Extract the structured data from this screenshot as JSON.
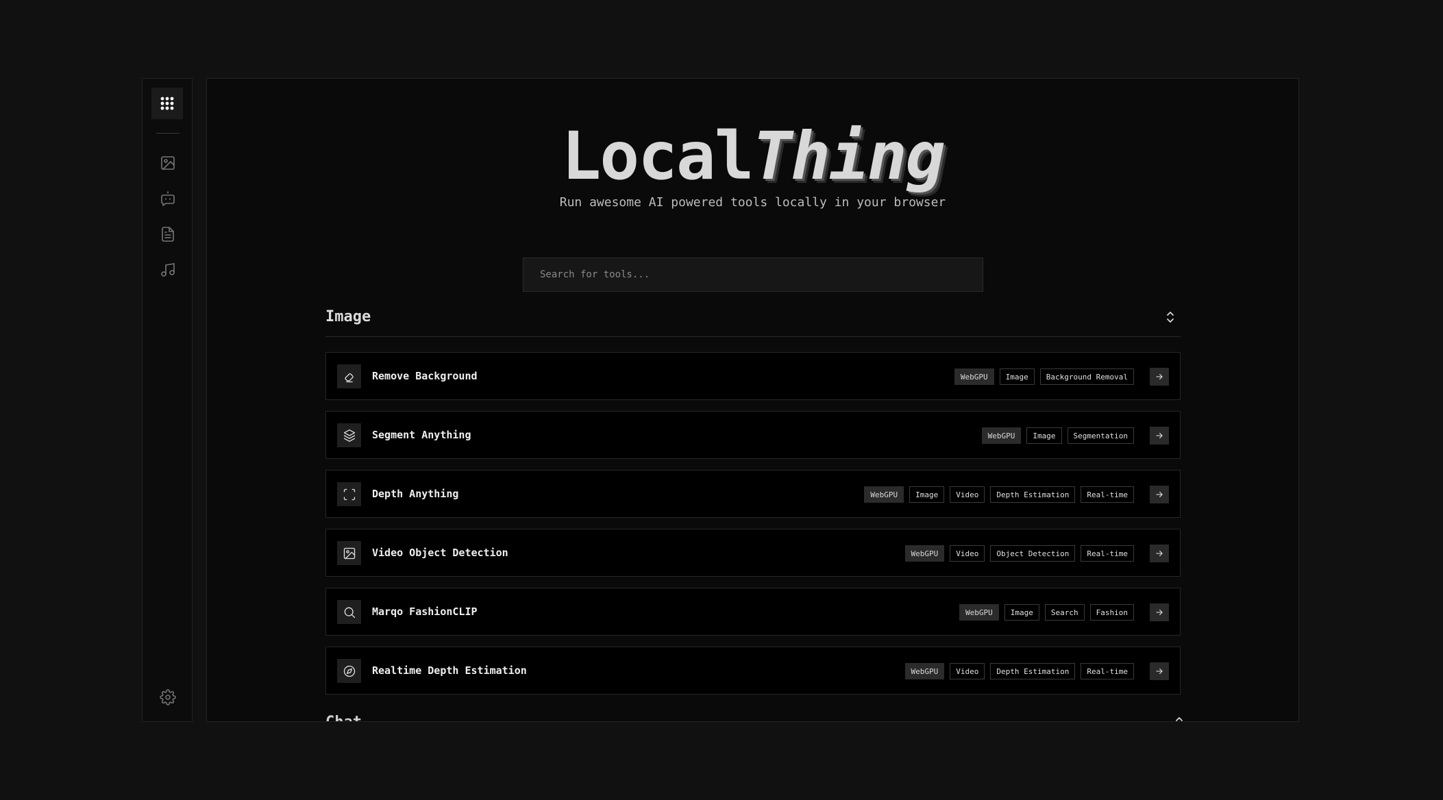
{
  "sidebar": {
    "logo_icon": "grid-dots-icon",
    "items": [
      {
        "name": "image",
        "icon": "image-icon"
      },
      {
        "name": "chat",
        "icon": "chat-bot-icon"
      },
      {
        "name": "document",
        "icon": "document-icon"
      },
      {
        "name": "audio",
        "icon": "music-note-icon"
      }
    ],
    "settings_icon": "gear-icon"
  },
  "hero": {
    "title_plain": "Local",
    "title_italic": "Thing",
    "subtitle": "Run awesome AI powered tools locally in your browser"
  },
  "search": {
    "placeholder": "Search for tools...",
    "value": ""
  },
  "sections": [
    {
      "title": "Image",
      "tools": [
        {
          "name": "Remove Background",
          "icon": "eraser-icon",
          "tags": [
            "WebGPU",
            "Image",
            "Background Removal"
          ]
        },
        {
          "name": "Segment Anything",
          "icon": "layers-icon",
          "tags": [
            "WebGPU",
            "Image",
            "Segmentation"
          ]
        },
        {
          "name": "Depth Anything",
          "icon": "focus-frame-icon",
          "tags": [
            "WebGPU",
            "Image",
            "Video",
            "Depth Estimation",
            "Real-time"
          ]
        },
        {
          "name": "Video Object Detection",
          "icon": "image-frame-icon",
          "tags": [
            "WebGPU",
            "Video",
            "Object Detection",
            "Real-time"
          ]
        },
        {
          "name": "Marqo FashionCLIP",
          "icon": "search-icon",
          "tags": [
            "WebGPU",
            "Image",
            "Search",
            "Fashion"
          ]
        },
        {
          "name": "Realtime Depth Estimation",
          "icon": "compass-icon",
          "tags": [
            "WebGPU",
            "Video",
            "Depth Estimation",
            "Real-time"
          ]
        }
      ]
    },
    {
      "title": "Chat"
    }
  ],
  "colors": {
    "background": "#111111",
    "panel": "#0a0a0a",
    "row": "#000000",
    "accent_tag": "#2b2b2b",
    "text": "#e6e6e6"
  }
}
